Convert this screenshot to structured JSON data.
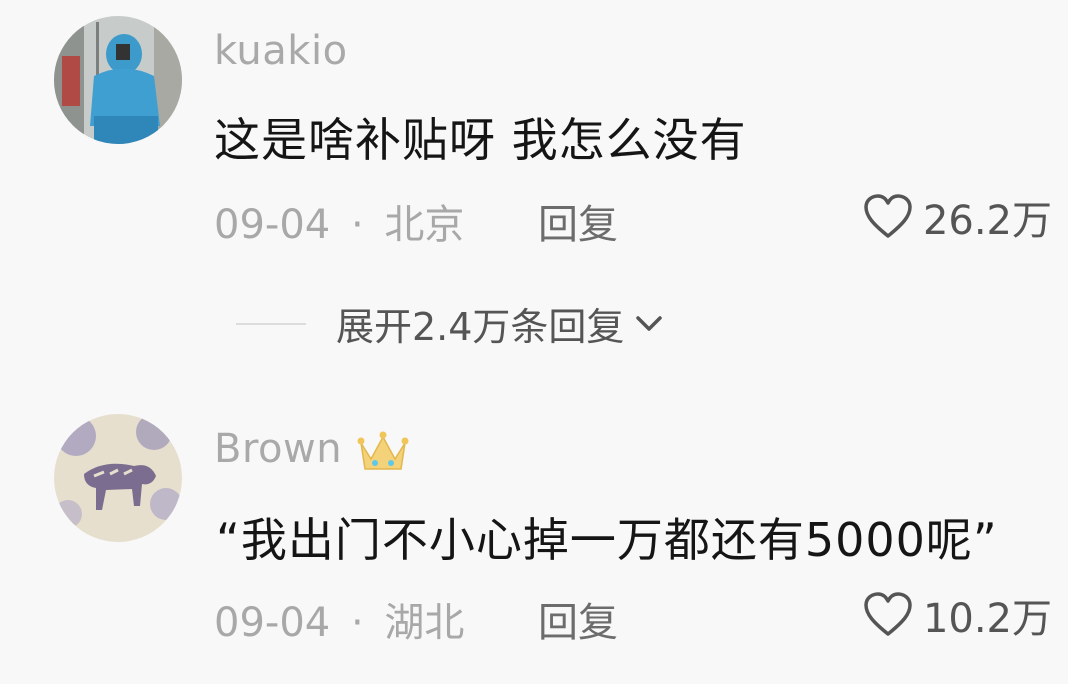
{
  "comments": [
    {
      "username": "kuakio",
      "text": "这是啥补贴呀 我怎么没有",
      "date": "09-04",
      "separator": "·",
      "location": "北京",
      "reply_label": "回复",
      "likes": "26.2万",
      "expand_label": "展开2.4万条回复"
    },
    {
      "username": "Brown",
      "text": "“我出门不小心掉一万都还有5000呢”",
      "date": "09-04",
      "separator": "·",
      "location": "湖北",
      "reply_label": "回复",
      "likes": "10.2万"
    }
  ],
  "colors": {
    "background": "#f8f8f8",
    "username": "#a9a9a9",
    "text": "#151515"
  }
}
